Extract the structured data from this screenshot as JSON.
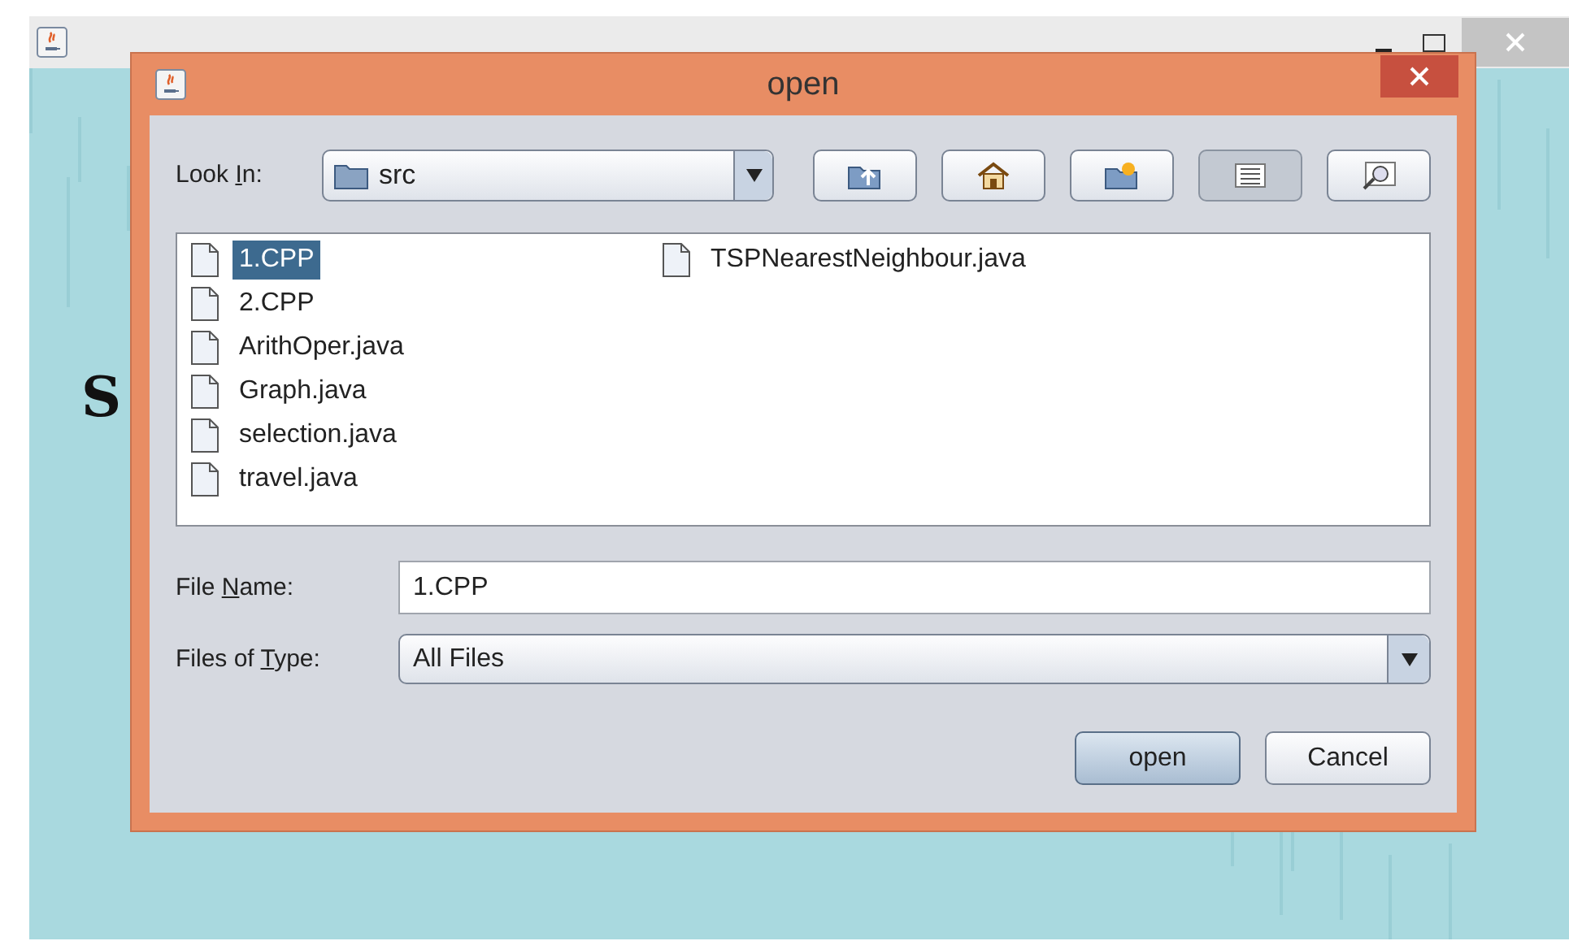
{
  "background_window": {
    "background_text": "S"
  },
  "dialog": {
    "title": "open",
    "look_in": {
      "label": {
        "pre": "Look ",
        "key": "I",
        "post": "n:"
      },
      "value": "src"
    },
    "toolbar": [
      {
        "kind": "up",
        "selected": false
      },
      {
        "kind": "home",
        "selected": false
      },
      {
        "kind": "new-folder",
        "selected": false
      },
      {
        "kind": "list",
        "selected": true
      },
      {
        "kind": "details",
        "selected": false
      }
    ],
    "files": [
      {
        "name": "1.CPP",
        "selected": true
      },
      {
        "name": "2.CPP",
        "selected": false
      },
      {
        "name": "ArithOper.java",
        "selected": false
      },
      {
        "name": "Graph.java",
        "selected": false
      },
      {
        "name": "selection.java",
        "selected": false
      },
      {
        "name": "travel.java",
        "selected": false
      },
      {
        "name": "TSPNearestNeighbour.java",
        "selected": false
      }
    ],
    "file_name": {
      "label": {
        "pre": "File ",
        "key": "N",
        "post": "ame:"
      },
      "value": "1.CPP"
    },
    "file_type": {
      "label": {
        "pre": "Files of ",
        "key": "T",
        "post": "ype:"
      },
      "value": "All Files"
    },
    "buttons": [
      {
        "label": "open",
        "kind": "primary"
      },
      {
        "label": "Cancel",
        "kind": "normal"
      }
    ]
  }
}
